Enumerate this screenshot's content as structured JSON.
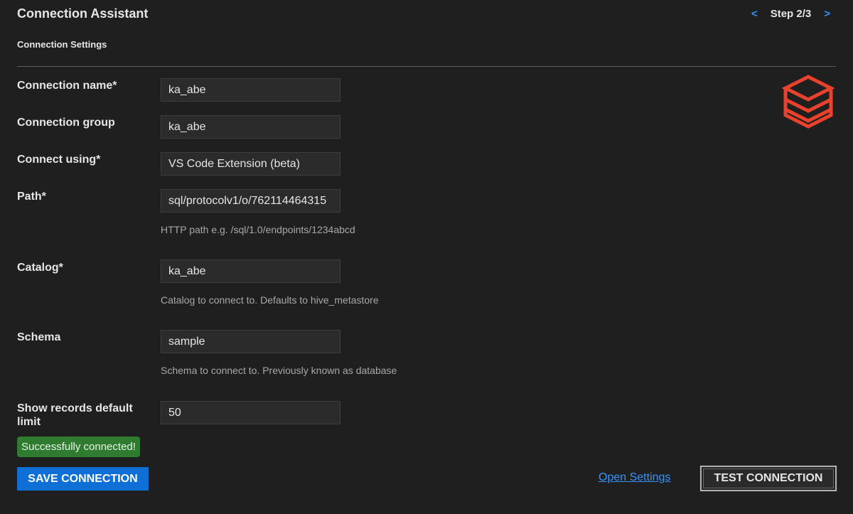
{
  "header": {
    "title": "Connection Assistant",
    "step_prev": "<",
    "step_label": "Step 2/3",
    "step_next": ">"
  },
  "section": {
    "title": "Connection Settings"
  },
  "logo": {
    "icon": "databricks-logo-icon",
    "color": "#e8412c"
  },
  "form": {
    "connection_name": {
      "label": "Connection name*",
      "value": "ka_abe"
    },
    "connection_group": {
      "label": "Connection group",
      "value": "ka_abe"
    },
    "connect_using": {
      "label": "Connect using*",
      "value": "VS Code Extension (beta)"
    },
    "path": {
      "label": "Path*",
      "value": "sql/protocolv1/o/762114464315",
      "hint": "HTTP path e.g. /sql/1.0/endpoints/1234abcd"
    },
    "catalog": {
      "label": "Catalog*",
      "value": "ka_abe",
      "hint": "Catalog to connect to. Defaults to hive_metastore"
    },
    "schema": {
      "label": "Schema",
      "value": "sample",
      "hint": "Schema to connect to. Previously known as database"
    },
    "records_limit": {
      "label": "Show records default limit",
      "value": "50"
    }
  },
  "status": {
    "message": "Successfully connected!",
    "color": "#2f7c31"
  },
  "actions": {
    "save_label": "SAVE CONNECTION",
    "open_settings_label": "Open Settings",
    "test_label": "TEST CONNECTION"
  }
}
